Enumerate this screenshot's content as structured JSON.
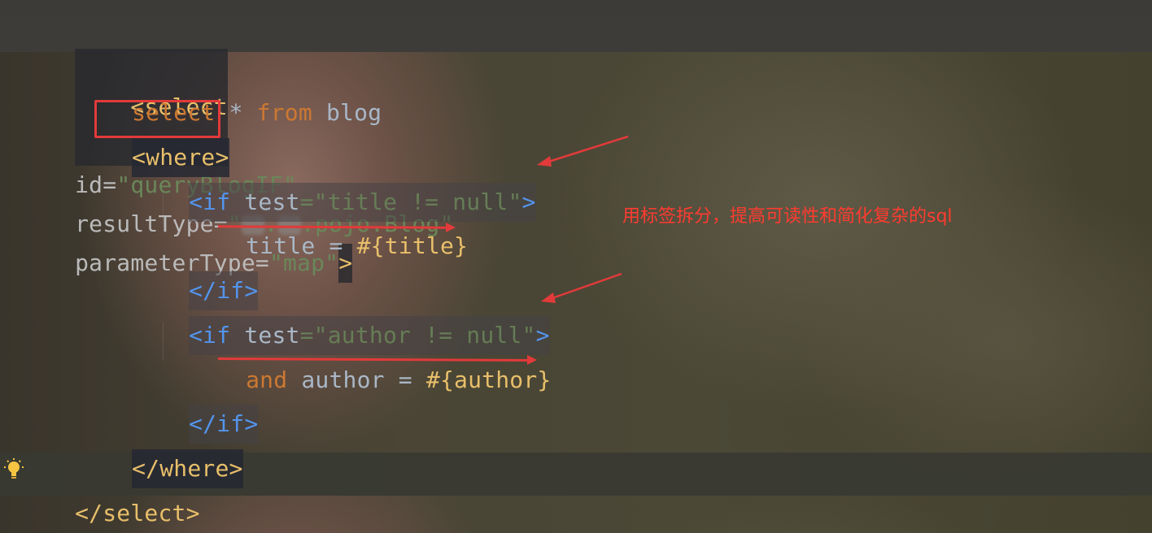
{
  "code": {
    "line1": {
      "open": "<select",
      "id_attr": "id",
      "id_val": "\"queryBlogIF\"",
      "rt_attr": "resultType",
      "rt_val_prefix": "\"",
      "rt_val_mid": ".",
      "rt_val_suffix": ".pojo.Blog\"",
      "pt_attr": "parameterType",
      "pt_val": "\"map\"",
      "close": ">"
    },
    "line2": {
      "kw1": "select",
      "star": "*",
      "kw2": "from",
      "table": "blog"
    },
    "line3": {
      "tag": "<where>"
    },
    "line4": {
      "open": "<if",
      "attr": "test",
      "val": "\"title != null\"",
      "close": ">"
    },
    "line5": {
      "field": "title",
      "eq": "=",
      "param": "#{title}"
    },
    "line6": {
      "close": "</if>"
    },
    "line7": {
      "open": "<if",
      "attr": "test",
      "val": "\"author != null\"",
      "close": ">"
    },
    "line8": {
      "kw": "and",
      "field": "author",
      "eq": "=",
      "param": "#{author}"
    },
    "line9": {
      "close": "</if>"
    },
    "line10": {
      "close": "</where>"
    },
    "line11": {
      "close": "</select>"
    }
  },
  "annotation": "用标签拆分，提高可读性和简化复杂的sql",
  "icons": {
    "bulb": "lightbulb-icon"
  },
  "colors": {
    "annotation": "#ff3b30",
    "tag": "#e8bf6a",
    "string": "#6a8759",
    "keyword": "#cc7832"
  }
}
